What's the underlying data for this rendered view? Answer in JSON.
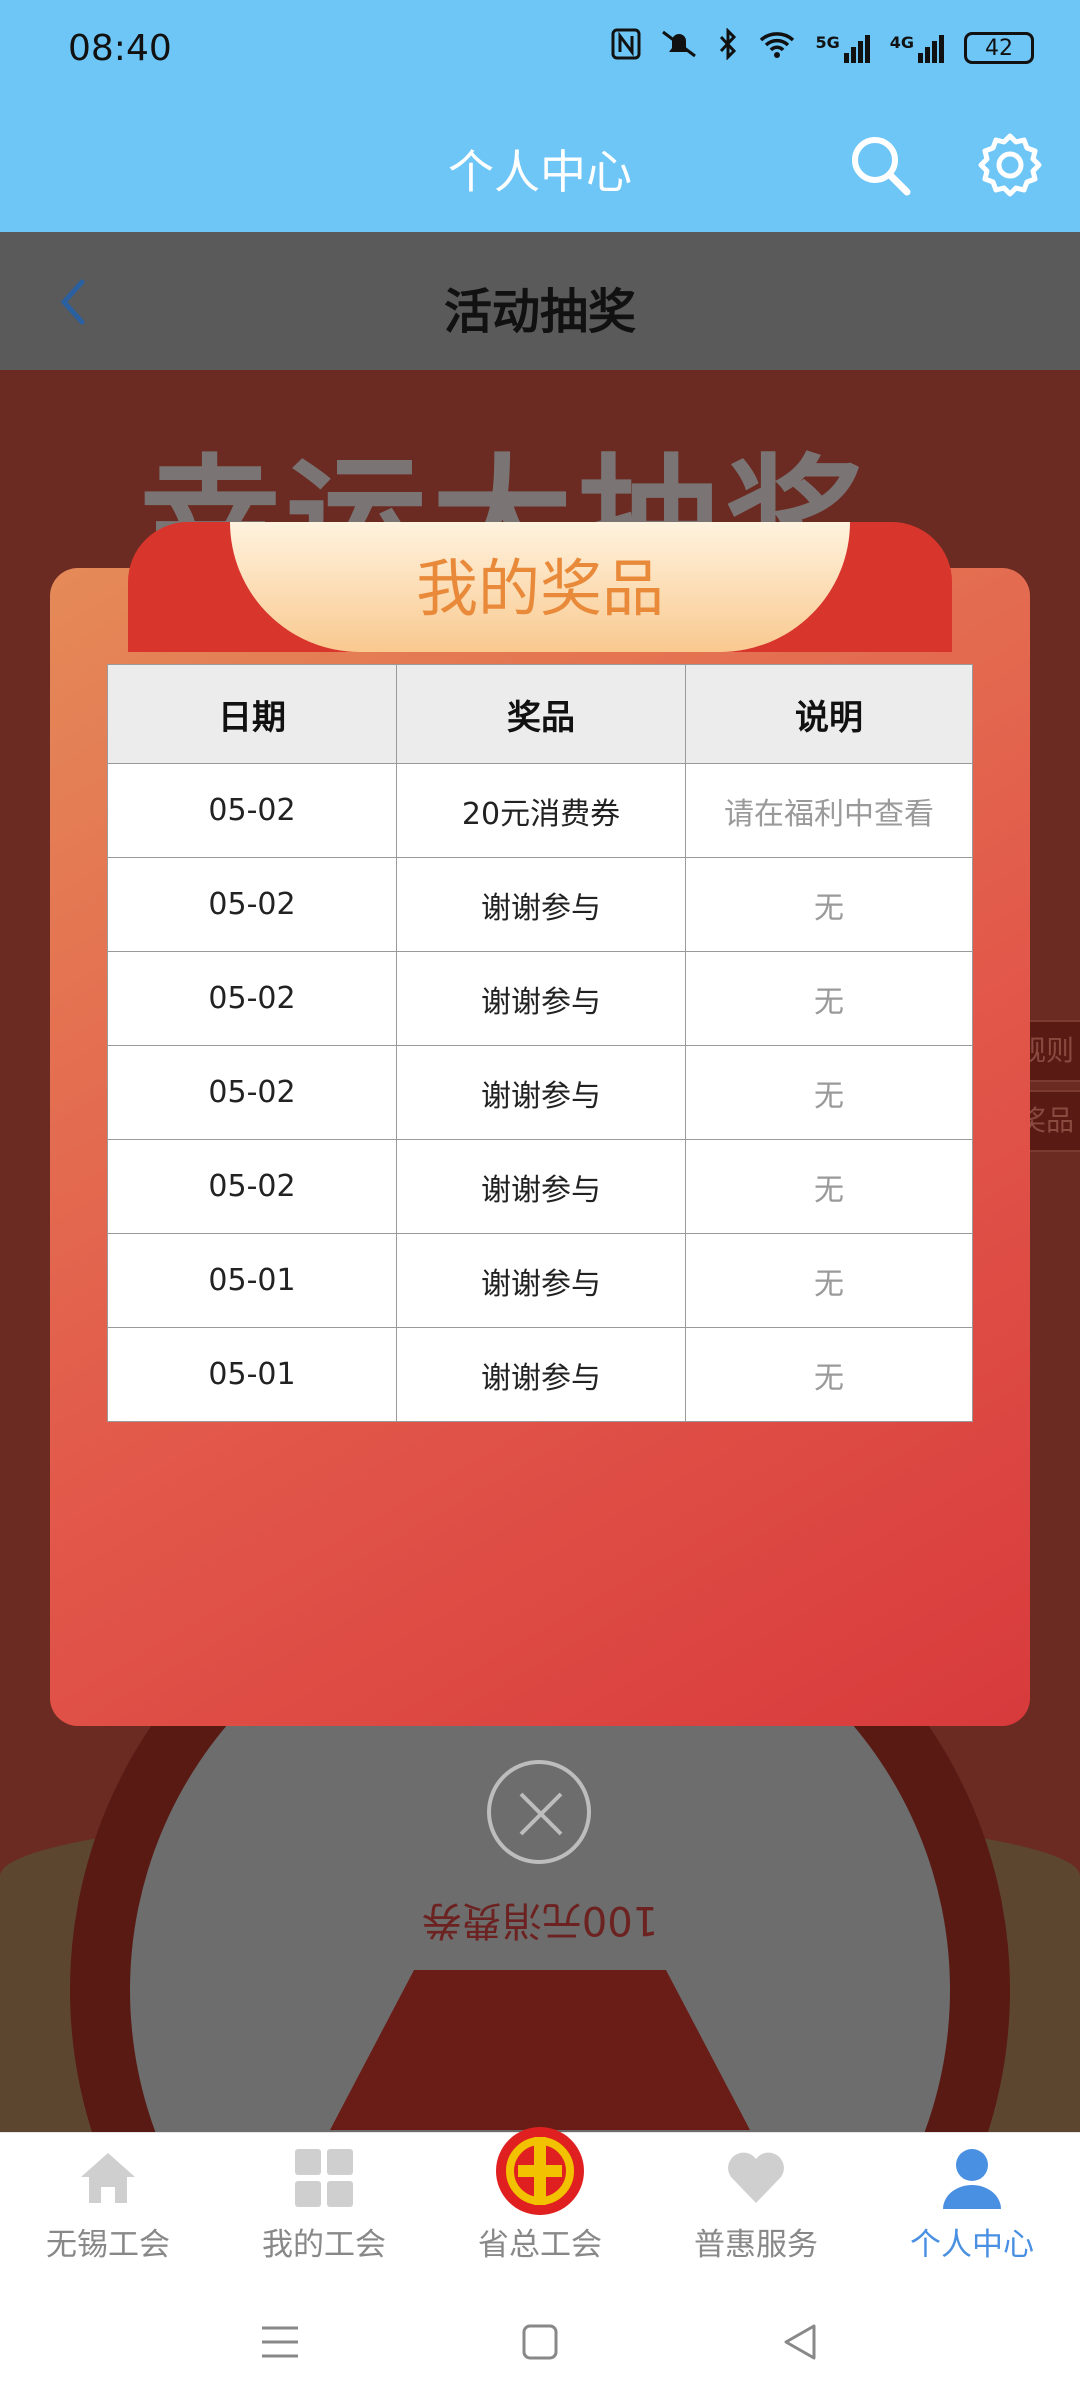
{
  "status_bar": {
    "time": "08:40",
    "signal_5g": "5G",
    "signal_4g": "4G",
    "battery": "42"
  },
  "header": {
    "title": "个人中心",
    "search_icon": "search-icon",
    "settings_icon": "gear-icon"
  },
  "page": {
    "title": "活动抽奖",
    "banner": "幸运大抽奖",
    "wheel_label": "100元消费券",
    "side_tabs": [
      "规则",
      "奖品"
    ]
  },
  "dialog": {
    "title": "我的奖品",
    "columns": [
      "日期",
      "奖品",
      "说明"
    ],
    "rows": [
      {
        "date": "05-02",
        "prize": "20元消费券",
        "note": "请在福利中查看"
      },
      {
        "date": "05-02",
        "prize": "谢谢参与",
        "note": "无"
      },
      {
        "date": "05-02",
        "prize": "谢谢参与",
        "note": "无"
      },
      {
        "date": "05-02",
        "prize": "谢谢参与",
        "note": "无"
      },
      {
        "date": "05-02",
        "prize": "谢谢参与",
        "note": "无"
      },
      {
        "date": "05-01",
        "prize": "谢谢参与",
        "note": "无"
      },
      {
        "date": "05-01",
        "prize": "谢谢参与",
        "note": "无"
      }
    ]
  },
  "bottom_nav": [
    {
      "label": "无锡工会",
      "icon": "home-icon"
    },
    {
      "label": "我的工会",
      "icon": "grid-icon"
    },
    {
      "label": "省总工会",
      "icon": "union-logo-icon"
    },
    {
      "label": "普惠服务",
      "icon": "heart-icon"
    },
    {
      "label": "个人中心",
      "icon": "person-icon",
      "active": true
    }
  ],
  "colors": {
    "header_bg": "#6ec6f7",
    "dialog_title": "#e88a3a",
    "active_nav": "#4a90e2"
  }
}
